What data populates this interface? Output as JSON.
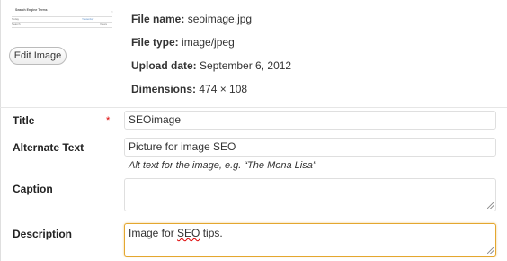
{
  "thumbnail": {
    "title": "Search Engine Terms",
    "row1_label": "Today",
    "row1_value": "Yesterday",
    "row2_label": "Search",
    "row2_value": "Views"
  },
  "edit_button": "Edit Image",
  "meta": {
    "file_name": {
      "label": "File name:",
      "value": "seoimage.jpg"
    },
    "file_type": {
      "label": "File type:",
      "value": "image/jpeg"
    },
    "upload_date": {
      "label": "Upload date:",
      "value": "September 6, 2012"
    },
    "dimensions": {
      "label": "Dimensions:",
      "value": "474 × 108"
    }
  },
  "fields": {
    "title": {
      "label": "Title",
      "required_marker": "*",
      "value": "SEOimage"
    },
    "alt": {
      "label": "Alternate Text",
      "value": "Picture for image SEO",
      "help": "Alt text for the image, e.g. “The Mona Lisa”"
    },
    "caption": {
      "label": "Caption",
      "value": ""
    },
    "description": {
      "label": "Description",
      "value_prefix": "Image for ",
      "value_misspelled": "SEO",
      "value_suffix": " tips."
    }
  },
  "colors": {
    "focus_border": "#e4a72f",
    "required": "#dd0000"
  }
}
